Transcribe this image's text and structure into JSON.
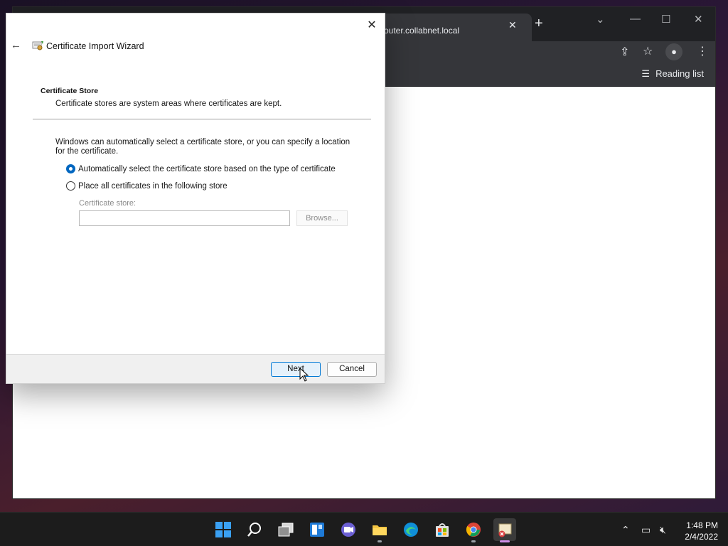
{
  "browser": {
    "tab_title": "outer.collabnet.local",
    "tab_close": "✕",
    "new_tab": "+",
    "reading_list_label": "Reading list"
  },
  "dialog": {
    "title": "Certificate Import Wizard",
    "close_glyph": "✕",
    "back_glyph": "←",
    "section_title": "Certificate Store",
    "section_description": "Certificate stores are system areas where certificates are kept.",
    "intro_text": "Windows can automatically select a certificate store, or you can specify a location for the certificate.",
    "radio_auto_label": "Automatically select the certificate store based on the type of certificate",
    "radio_auto_checked": true,
    "radio_manual_label": "Place all certificates in the following store",
    "radio_manual_checked": false,
    "store_label": "Certificate store:",
    "store_value": "",
    "browse_label": "Browse...",
    "next_label": "Next",
    "cancel_label": "Cancel"
  },
  "taskbar": {
    "time": "1:48 PM",
    "date": "2/4/2022",
    "apps": [
      "start-icon",
      "search-icon",
      "task-view-icon",
      "widgets-icon",
      "teams-chat-icon",
      "file-explorer-icon",
      "edge-icon",
      "store-icon",
      "chrome-icon",
      "certificate-manager-icon"
    ]
  },
  "colors": {
    "accent": "#0067c0",
    "taskbar": "#1c1c1c",
    "browser_chrome": "#35363a"
  }
}
